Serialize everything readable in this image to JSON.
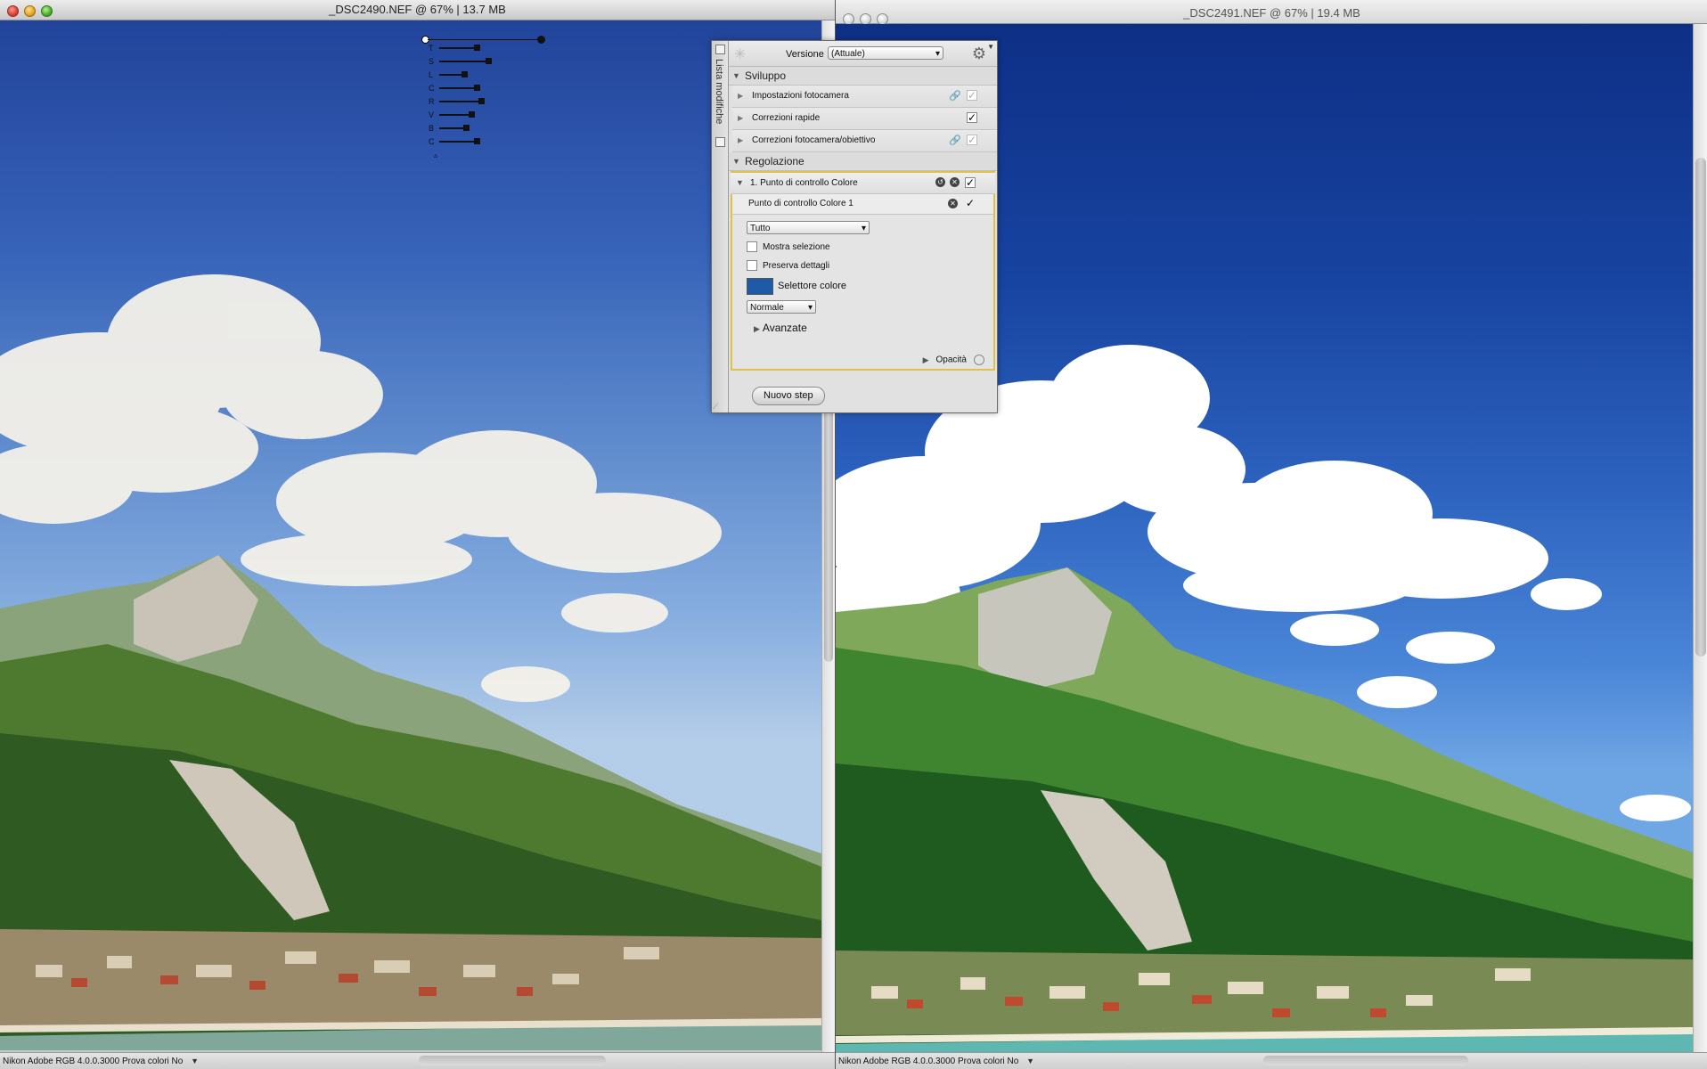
{
  "left_window": {
    "title": "_DSC2490.NEF @ 67% | 13.7 MB",
    "status_profile": "Nikon Adobe RGB 4.0.0.3000",
    "status_softproof": "Prova colori No"
  },
  "right_window": {
    "title": "_DSC2491.NEF @ 67% | 19.4 MB",
    "status_profile": "Nikon Adobe RGB 4.0.0.3000",
    "status_softproof": "Prova colori No"
  },
  "control_point_sliders": [
    {
      "letter": "T",
      "level": 0.42
    },
    {
      "letter": "S",
      "level": 0.55
    },
    {
      "letter": "L",
      "level": 0.28
    },
    {
      "letter": "C",
      "level": 0.42
    },
    {
      "letter": "R",
      "level": 0.47
    },
    {
      "letter": "V",
      "level": 0.36
    },
    {
      "letter": "B",
      "level": 0.3
    },
    {
      "letter": "C",
      "level": 0.42
    }
  ],
  "palette": {
    "side_label": "Lista modifiche",
    "version_label": "Versione",
    "version_value": "(Attuale)",
    "sections": {
      "develop": "Sviluppo",
      "adjust": "Regolazione"
    },
    "develop_items": [
      {
        "label": "Impostazioni fotocamera",
        "checked": true,
        "dim": true
      },
      {
        "label": "Correzioni rapide",
        "checked": true,
        "dim": false
      },
      {
        "label": "Correzioni fotocamera/obiettivo",
        "checked": true,
        "dim": true
      }
    ],
    "control_point": {
      "title": "1. Punto di controllo Colore",
      "sub_title": "Punto di controllo Colore 1",
      "channel_select": "Tutto",
      "show_selection": "Mostra selezione",
      "preserve_detail": "Preserva dettagli",
      "color_picker": "Selettore colore",
      "picker_color": "#1e5aa8",
      "blend_mode": "Normale",
      "advanced": "Avanzate",
      "opacity": "Opacità"
    },
    "new_step": "Nuovo step"
  }
}
